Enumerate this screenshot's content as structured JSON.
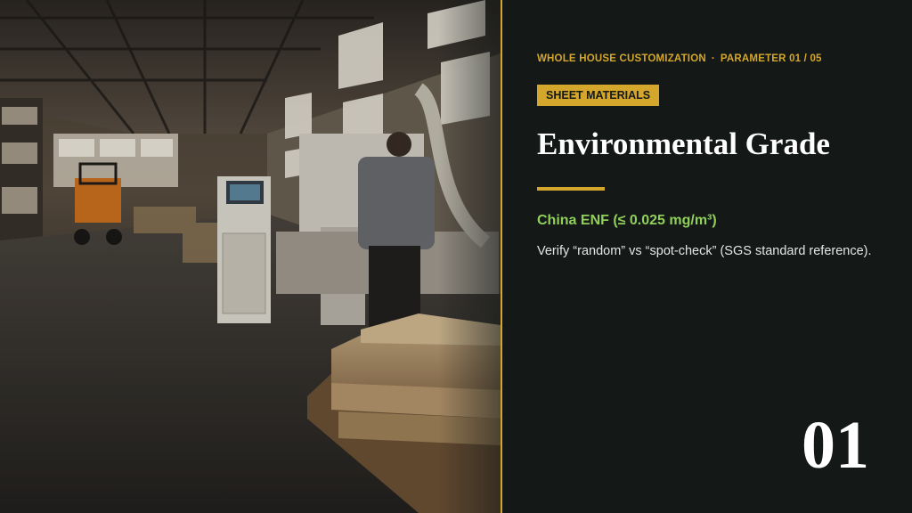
{
  "header": {
    "section": "WHOLE HOUSE CUSTOMIZATION",
    "separator": "·",
    "parameter": "PARAMETER 01 / 05"
  },
  "badge": {
    "label": "SHEET MATERIALS"
  },
  "title": "Environmental Grade",
  "standard": {
    "label": "China ENF (≤ 0.025 mg/m³)"
  },
  "description": "Verify “random” vs “spot-check” (SGS standard reference).",
  "slide_number": "01",
  "image": {
    "subject": "factory-workshop-photo"
  },
  "colors": {
    "background": "#141817",
    "accent": "#d4a72c",
    "standard_text": "#8fcf5a",
    "title_text": "#ffffff"
  }
}
